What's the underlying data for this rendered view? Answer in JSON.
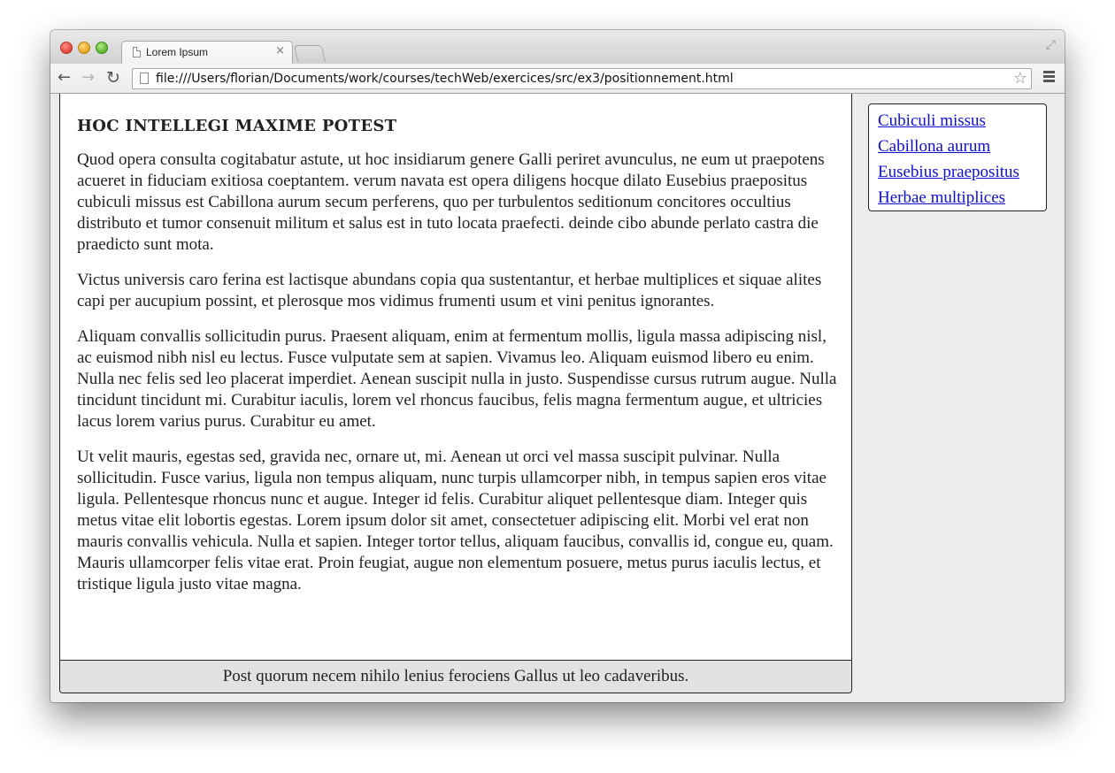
{
  "browser": {
    "tab_title": "Lorem Ipsum",
    "tab_close": "×",
    "url": "file:///Users/florian/Documents/work/courses/techWeb/exercices/src/ex3/positionnement.html",
    "icons": {
      "back": "←",
      "forward": "→",
      "reload": "↻",
      "star": "☆",
      "fullscreen": "⤢"
    }
  },
  "page": {
    "heading": "HOC INTELLEGI MAXIME POTEST",
    "paragraphs": [
      "Quod opera consulta cogitabatur astute, ut hoc insidiarum genere Galli periret avunculus, ne eum ut praepotens acueret in fiduciam exitiosa coeptantem. verum navata est opera diligens hocque dilato Eusebius praepositus cubiculi missus est Cabillona aurum secum perferens, quo per turbulentos seditionum concitores occultius distributo et tumor consenuit militum et salus est in tuto locata praefecti. deinde cibo abunde perlato castra die praedicto sunt mota.",
      "Victus universis caro ferina est lactisque abundans copia qua sustentantur, et herbae multiplices et siquae alites capi per aucupium possint, et plerosque mos vidimus frumenti usum et vini penitus ignorantes.",
      "Aliquam convallis sollicitudin purus. Praesent aliquam, enim at fermentum mollis, ligula massa adipiscing nisl, ac euismod nibh nisl eu lectus. Fusce vulputate sem at sapien. Vivamus leo. Aliquam euismod libero eu enim. Nulla nec felis sed leo placerat imperdiet. Aenean suscipit nulla in justo. Suspendisse cursus rutrum augue. Nulla tincidunt tincidunt mi. Curabitur iaculis, lorem vel rhoncus faucibus, felis magna fermentum augue, et ultricies lacus lorem varius purus. Curabitur eu amet.",
      "Ut velit mauris, egestas sed, gravida nec, ornare ut, mi. Aenean ut orci vel massa suscipit pulvinar. Nulla sollicitudin. Fusce varius, ligula non tempus aliquam, nunc turpis ullamcorper nibh, in tempus sapien eros vitae ligula. Pellentesque rhoncus nunc et augue. Integer id felis. Curabitur aliquet pellentesque diam. Integer quis metus vitae elit lobortis egestas. Lorem ipsum dolor sit amet, consectetuer adipiscing elit. Morbi vel erat non mauris convallis vehicula. Nulla et sapien. Integer tortor tellus, aliquam faucibus, convallis id, congue eu, quam. Mauris ullamcorper felis vitae erat. Proin feugiat, augue non elementum posuere, metus purus iaculis lectus, et tristique ligula justo vitae magna."
    ],
    "footer": "Post quorum necem nihilo lenius ferociens Gallus ut leo cadaveribus.",
    "sidebar_links": [
      "Cubiculi missus",
      "Cabillona aurum",
      "Eusebius praepositus",
      "Herbae multiplices"
    ],
    "link_color": "#1010cc"
  }
}
